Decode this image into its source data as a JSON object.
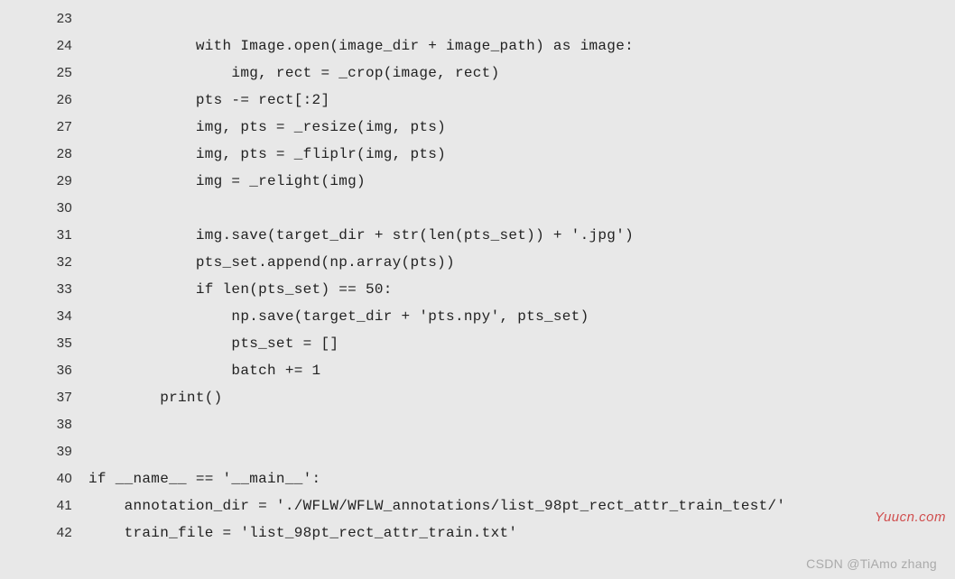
{
  "watermarks": {
    "right": "Yuucn.com",
    "bottom": "CSDN @TiAmo zhang"
  },
  "startLine": 23,
  "lines": [
    "",
    "            with Image.open(image_dir + image_path) as image:",
    "                img, rect = _crop(image, rect)",
    "            pts -= rect[:2]",
    "            img, pts = _resize(img, pts)",
    "            img, pts = _fliplr(img, pts)",
    "            img = _relight(img)",
    "",
    "            img.save(target_dir + str(len(pts_set)) + '.jpg')",
    "            pts_set.append(np.array(pts))",
    "            if len(pts_set) == 50:",
    "                np.save(target_dir + 'pts.npy', pts_set)",
    "                pts_set = []",
    "                batch += 1",
    "        print()",
    "",
    "",
    "if __name__ == '__main__':",
    "    annotation_dir = './WFLW/WFLW_annotations/list_98pt_rect_attr_train_test/'",
    "    train_file = 'list_98pt_rect_attr_train.txt'"
  ]
}
